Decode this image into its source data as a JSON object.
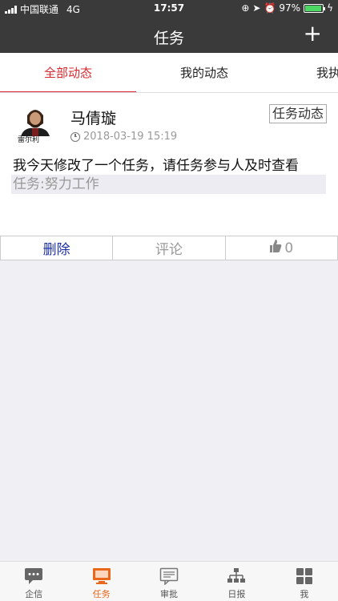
{
  "status": {
    "carrier": "中国联通",
    "network": "4G",
    "time": "17:57",
    "battery": "97%",
    "battery_level": 0.97
  },
  "nav": {
    "title": "任务",
    "add_label": "+"
  },
  "tabs": [
    {
      "label": "全部动态",
      "active": true
    },
    {
      "label": "我的动态",
      "active": false
    },
    {
      "label": "我执行中",
      "active": false
    }
  ],
  "post": {
    "author": "马倩璇",
    "avatar_text": "雷尔利",
    "timestamp": "2018-03-19 15:19",
    "type_badge": "任务动态",
    "content": "我今天修改了一个任务，请任务参与人及时查看",
    "task_link": "任务:努力工作"
  },
  "actions": {
    "delete": "删除",
    "comment": "评论",
    "like_count": "0"
  },
  "bottom_tabs": [
    {
      "label": "企信",
      "icon": "chat-icon",
      "active": false
    },
    {
      "label": "任务",
      "icon": "monitor-icon",
      "active": true
    },
    {
      "label": "审批",
      "icon": "document-icon",
      "active": false
    },
    {
      "label": "日报",
      "icon": "org-chart-icon",
      "active": false
    },
    {
      "label": "我",
      "icon": "grid-icon",
      "active": false
    }
  ],
  "colors": {
    "accent": "#d9282e",
    "active_tab": "#e8671a",
    "delete": "#1b2fa8",
    "bar": "#3a3a3a"
  }
}
